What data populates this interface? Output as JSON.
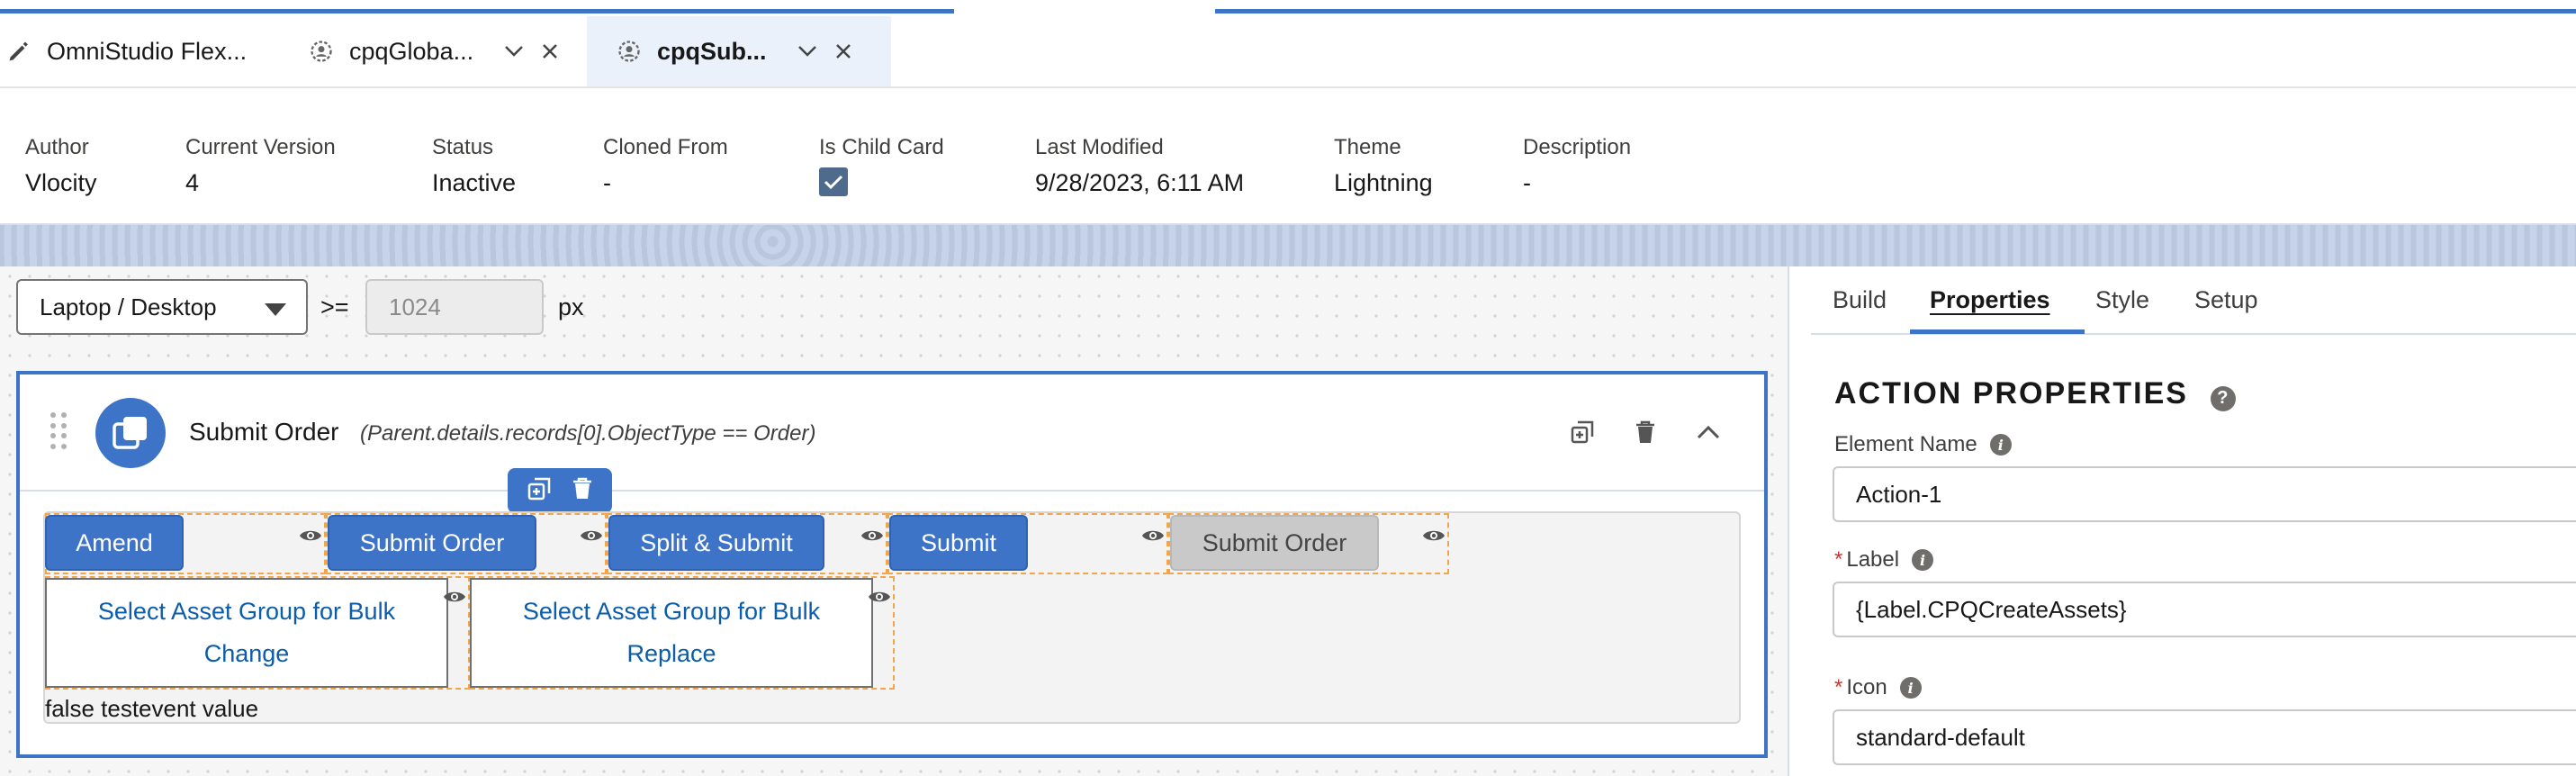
{
  "tabs": [
    {
      "label": "OmniStudio Flex...",
      "icon": "pencil-icon"
    },
    {
      "label": "cpqGloba...",
      "icon": "flexcard-icon"
    },
    {
      "label": "cpqSub...",
      "icon": "flexcard-icon",
      "active": true
    }
  ],
  "meta": {
    "author": {
      "label": "Author",
      "value": "Vlocity"
    },
    "version": {
      "label": "Current Version",
      "value": "4"
    },
    "status": {
      "label": "Status",
      "value": "Inactive"
    },
    "cloned": {
      "label": "Cloned From",
      "value": "-"
    },
    "child": {
      "label": "Is Child Card",
      "checked": true
    },
    "modified": {
      "label": "Last Modified",
      "value": "9/28/2023, 6:11 AM"
    },
    "theme": {
      "label": "Theme",
      "value": "Lightning"
    },
    "description": {
      "label": "Description",
      "value": "-"
    }
  },
  "canvas": {
    "device": "Laptop / Desktop",
    "operator": ">=",
    "width_placeholder": "1024",
    "unit": "px",
    "card": {
      "title": "Submit Order",
      "condition": "(Parent.details.records[0].ObjectType == Order)",
      "buttons": {
        "amend": "Amend",
        "submit_order": "Submit Order",
        "split_submit": "Split & Submit",
        "submit": "Submit",
        "submit_order_disabled": "Submit Order"
      },
      "links": {
        "change": {
          "line1": "Select Asset Group for Bulk",
          "line2": "Change"
        },
        "replace": {
          "line1": "Select Asset Group for Bulk",
          "line2": "Replace"
        }
      },
      "text": "false testevent value"
    }
  },
  "panel": {
    "tabs": {
      "build": "Build",
      "properties": "Properties",
      "style": "Style",
      "setup": "Setup"
    },
    "section_title": "ACTION PROPERTIES",
    "fields": {
      "element_name": {
        "label": "Element Name",
        "value": "Action-1"
      },
      "label": {
        "label": "Label",
        "value": "{Label.CPQCreateAssets}",
        "required": "*"
      },
      "icon": {
        "label": "Icon",
        "value": "standard-default",
        "required": "*"
      }
    }
  },
  "colors": {
    "brand": "#3d74c8",
    "dash": "#f2a64a"
  }
}
